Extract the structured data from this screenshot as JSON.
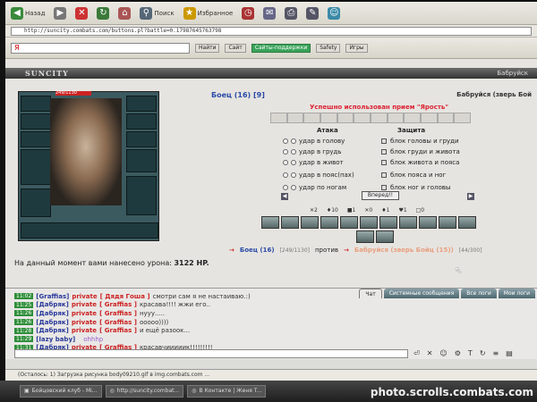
{
  "browser": {
    "toolbar": {
      "back_label": "Назад",
      "search_label": "Поиск",
      "favorites_label": "Избранное"
    },
    "address": {
      "label": "",
      "url": "http://suncity.combats.com/buttons.pl?battle=0.17987645763798"
    },
    "search_bar": {
      "label": "Найти",
      "value": "Я",
      "chips": [
        "Найти",
        "Сайт",
        "Сайты-поддержки",
        "Safety",
        "Игры"
      ]
    },
    "status_text": "(Осталось: 1) Загрузка рисунка body09210.gif в img.combats.com ..."
  },
  "game": {
    "logo": "SUNCITY",
    "top_right": "Бабруйск",
    "player_hp_text": "249/1130",
    "title": "Боец (16) [9]",
    "enemy_title": "Бабруйся (зверь Бой",
    "used_text": "Успешно использован прием \"Ярость\"",
    "attack_header": "Атака",
    "defense_header": "Защита",
    "attacks": [
      "удар в голову",
      "удар в грудь",
      "удар в живот",
      "удар в пояс(пах)",
      "удар по ногам"
    ],
    "defenses": [
      "блок головы и груди",
      "блок груди и живота",
      "блок живота и пояса",
      "блок пояса и ног",
      "блок ног и головы"
    ],
    "go_button": "Вперед!!",
    "counts": [
      "✕2",
      "♦10",
      "■1",
      "✕0",
      "♦1",
      "♥1",
      "□0"
    ],
    "player_name": "Боец (16)",
    "player_hp": "[249/1130]",
    "vs_label": "против",
    "enemy_name": "Бабруйся (зверь Бойц (15))",
    "enemy_hp": "[44/300]",
    "damage_prefix": "На данный момент вами нанесено урона:",
    "damage_value": "3122 HP."
  },
  "chat": {
    "tabs": [
      "Чат",
      "Системные сообщения",
      "Все логи",
      "Мои логи"
    ],
    "messages": [
      {
        "time": "11:02",
        "nick": "[Graffias]",
        "priv": "private",
        "to": "[ Дядя Гоша ]",
        "text": "смотри сам я не настаиваю.:)",
        "lilac": false
      },
      {
        "time": "11:25",
        "nick": "[Дабряк]",
        "priv": "private",
        "to": "[ Graffias ]",
        "text": "красава!!!! жжи его..",
        "lilac": false
      },
      {
        "time": "11:26",
        "nick": "[Дабряк]",
        "priv": "private",
        "to": "[ Graffias ]",
        "text": "нууу.....",
        "lilac": false
      },
      {
        "time": "11:26",
        "nick": "[Дабряк]",
        "priv": "private",
        "to": "[ Graffias ]",
        "text": "ооооо))))",
        "lilac": false
      },
      {
        "time": "11:28",
        "nick": "[Дабряк]",
        "priv": "private",
        "to": "[ Graffias ]",
        "text": "и ещё разоок...",
        "lilac": false
      },
      {
        "time": "11:29",
        "nick": "[lazy baby]",
        "priv": "",
        "to": "",
        "text": "ohhhp",
        "lilac": true
      },
      {
        "time": "11:31",
        "nick": "[Дабряк]",
        "priv": "private",
        "to": "[ Graffias ]",
        "text": "красавчииииик!!!!!!!!!",
        "lilac": false
      }
    ]
  },
  "taskbar": {
    "items": [
      "Бойцовский клуб - Mi...",
      "http://suncity.combat...",
      "В Контакте | Женя T..."
    ]
  },
  "watermark": "photo.scrolls.combats.com",
  "colors": {
    "accent_blue": "#2a4aa8",
    "danger_red": "#c22",
    "chat_time_green": "#2f8f3a"
  }
}
